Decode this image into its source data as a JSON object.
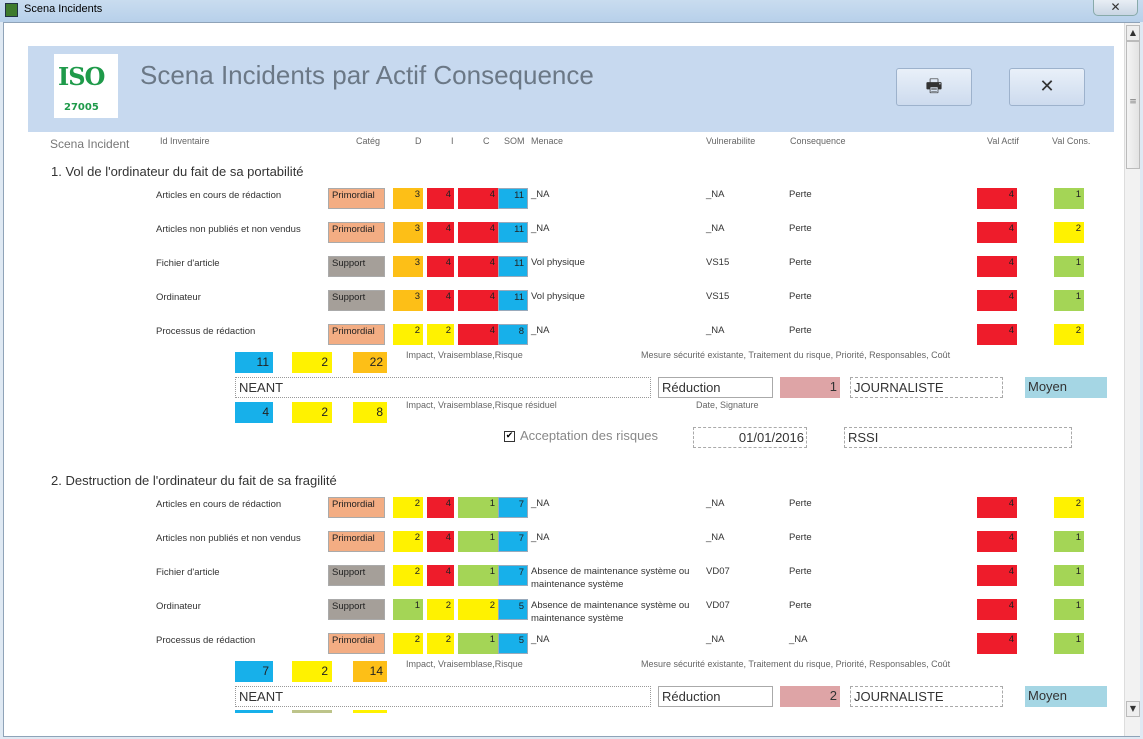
{
  "window": {
    "title": "Scena Incidents",
    "close": "✕"
  },
  "header": {
    "title": "Scena Incidents par Actif Consequence",
    "logo_text": "ISO",
    "logo_number": "27005",
    "print_icon": "🖶",
    "close_icon": "✕"
  },
  "columns": {
    "scena": "Scena Incident",
    "id": "Id Inventaire",
    "categ": "Catég",
    "d": "D",
    "i": "I",
    "c": "C",
    "som": "SOM",
    "menace": "Menace",
    "vuln": "Vulnerabilite",
    "cons": "Consequence",
    "val_actif": "Val Actif",
    "val_cons": "Val Cons."
  },
  "colors": {
    "orange": "#fdbf17",
    "red": "#ee1c2b",
    "yellow": "#fff200",
    "blue": "#17b0ea",
    "green": "#a4d556",
    "primordial": "#f3ad83",
    "support": "#a59f99"
  },
  "scenarios": [
    {
      "title": "1. Vol de l'ordinateur du fait de sa portabilité",
      "rows": [
        {
          "asset": "Articles en cours de rédaction",
          "cat": "Primordial",
          "d": "3",
          "i": "4",
          "c": "4",
          "som": "11",
          "menace": "_NA",
          "vuln": "_NA",
          "cons": "Perte",
          "val_actif": "4",
          "val_cons": "1"
        },
        {
          "asset": "Articles non publiés et non vendus",
          "cat": "Primordial",
          "d": "3",
          "i": "4",
          "c": "4",
          "som": "11",
          "menace": "_NA",
          "vuln": "_NA",
          "cons": "Perte",
          "val_actif": "4",
          "val_cons": "2"
        },
        {
          "asset": "Fichier d'article",
          "cat": "Support",
          "d": "3",
          "i": "4",
          "c": "4",
          "som": "11",
          "menace": "Vol physique",
          "vuln": "VS15",
          "cons": "Perte",
          "val_actif": "4",
          "val_cons": "1"
        },
        {
          "asset": "Ordinateur",
          "cat": "Support",
          "d": "3",
          "i": "4",
          "c": "4",
          "som": "11",
          "menace": "Vol physique",
          "vuln": "VS15",
          "cons": "Perte",
          "val_actif": "4",
          "val_cons": "1"
        },
        {
          "asset": "Processus de rédaction",
          "cat": "Primordial",
          "d": "2",
          "i": "2",
          "c": "4",
          "som": "8",
          "menace": "_NA",
          "vuln": "_NA",
          "cons": "Perte",
          "val_actif": "4",
          "val_cons": "2"
        }
      ],
      "impact": "11",
      "vrais": "2",
      "risque": "22",
      "impact_label": "Impact, Vraisemblase,Risque",
      "mesure_label": "Mesure sécurité existante, Traitement du risque, Priorité, Responsables, Coût",
      "mesure": "NEANT",
      "traitement": "Réduction",
      "priorite": "1",
      "responsable": "JOURNALISTE",
      "cout": "Moyen",
      "impact_res": "4",
      "vrais_res": "2",
      "risque_res": "8",
      "res_label": "Impact, Vraisemblase,Risque résiduel",
      "date_label": "Date, Signature",
      "accept_label": "Acceptation des risques",
      "accepted": true,
      "date": "01/01/2016",
      "signature": "RSSI"
    },
    {
      "title": "2. Destruction de l'ordinateur du fait de sa fragilité",
      "rows": [
        {
          "asset": "Articles en cours de rédaction",
          "cat": "Primordial",
          "d": "2",
          "i": "4",
          "c": "1",
          "som": "7",
          "menace": "_NA",
          "vuln": "_NA",
          "cons": "Perte",
          "val_actif": "4",
          "val_cons": "2"
        },
        {
          "asset": "Articles non publiés et non vendus",
          "cat": "Primordial",
          "d": "2",
          "i": "4",
          "c": "1",
          "som": "7",
          "menace": "_NA",
          "vuln": "_NA",
          "cons": "Perte",
          "val_actif": "4",
          "val_cons": "1"
        },
        {
          "asset": "Fichier d'article",
          "cat": "Support",
          "d": "2",
          "i": "4",
          "c": "1",
          "som": "7",
          "menace": "Absence de maintenance système ou maintenance système",
          "vuln": "VD07",
          "cons": "Perte",
          "val_actif": "4",
          "val_cons": "1"
        },
        {
          "asset": "Ordinateur",
          "cat": "Support",
          "d": "1",
          "i": "2",
          "c": "2",
          "som": "5",
          "menace": "Absence de maintenance système ou maintenance système",
          "vuln": "VD07",
          "cons": "Perte",
          "val_actif": "4",
          "val_cons": "1"
        },
        {
          "asset": "Processus de rédaction",
          "cat": "Primordial",
          "d": "2",
          "i": "2",
          "c": "1",
          "som": "5",
          "menace": "_NA",
          "vuln": "_NA",
          "cons": "_NA",
          "val_actif": "4",
          "val_cons": "1"
        }
      ],
      "impact": "7",
      "vrais": "2",
      "risque": "14",
      "impact_label": "Impact, Vraisemblase,Risque",
      "mesure_label": "Mesure sécurité existante, Traitement du risque, Priorité, Responsables, Coût",
      "mesure": "NEANT",
      "traitement": "Réduction",
      "priorite": "2",
      "responsable": "JOURNALISTE",
      "cout": "Moyen"
    }
  ]
}
